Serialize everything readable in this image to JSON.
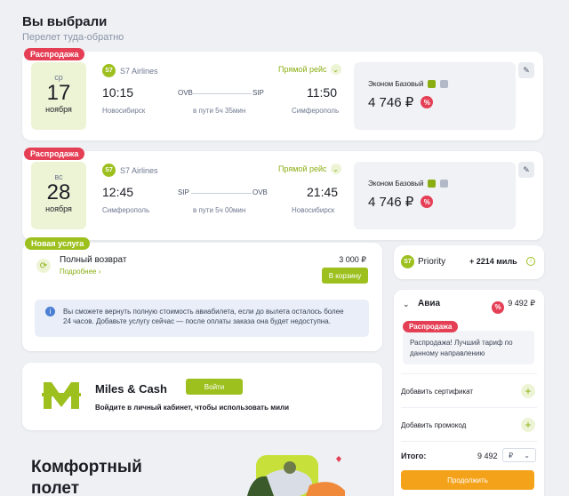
{
  "header": {
    "title": "Вы выбрали",
    "subtitle": "Перелет туда-обратно"
  },
  "flights": [
    {
      "badge": "Распродажа",
      "date": {
        "dow": "ср",
        "day": "17",
        "month": "ноября"
      },
      "airline": "S7 Airlines",
      "direct": "Прямой рейс",
      "dep_time": "10:15",
      "arr_time": "11:50",
      "from_code": "OVB",
      "to_code": "SIP",
      "from_city": "Новосибирск",
      "to_city": "Симферополь",
      "duration": "в пути 5ч 35мин",
      "fare_name": "Эконом Базовый",
      "price": "4 746 ₽"
    },
    {
      "badge": "Распродажа",
      "date": {
        "dow": "вс",
        "day": "28",
        "month": "ноября"
      },
      "airline": "S7 Airlines",
      "direct": "Прямой рейс",
      "dep_time": "12:45",
      "arr_time": "21:45",
      "from_code": "SIP",
      "to_code": "OVB",
      "from_city": "Симферополь",
      "to_city": "Новосибирск",
      "duration": "в пути 5ч 00мин",
      "fare_name": "Эконом Базовый",
      "price": "4 746 ₽"
    }
  ],
  "service": {
    "badge": "Новая услуга",
    "title": "Полный возврат",
    "more": "Подробнее ›",
    "price": "3 000 ₽",
    "cart_label": "В корзину",
    "info": "Вы сможете вернуть полную стоимость авиабилета, если до вылета осталось более 24 часов. Добавьте услугу сейчас — после оплаты заказа она будет недоступна."
  },
  "miles_cash": {
    "title": "Miles & Cash",
    "login_label": "Войти",
    "desc": "Войдите в личный кабинет, чтобы использовать мили"
  },
  "promo": {
    "title": "Комфортный полет"
  },
  "priority": {
    "logo": "S7",
    "label": "Priority",
    "miles": "+ 2214 миль"
  },
  "summary": {
    "avia_label": "Авиа",
    "avia_price": "9 492 ₽",
    "sale_badge": "Распродажа",
    "sale_note": "Распродажа! Лучший тариф по данному направлению",
    "add_certificate": "Добавить сертификат",
    "add_promocode": "Добавить промокод",
    "total_label": "Итого:",
    "total_value": "9 492",
    "currency": "₽",
    "continue_label": "Продолжить"
  },
  "colors": {
    "accent_green": "#9dc01f",
    "sale_red": "#e53f55",
    "continue_orange": "#f5a21b"
  }
}
